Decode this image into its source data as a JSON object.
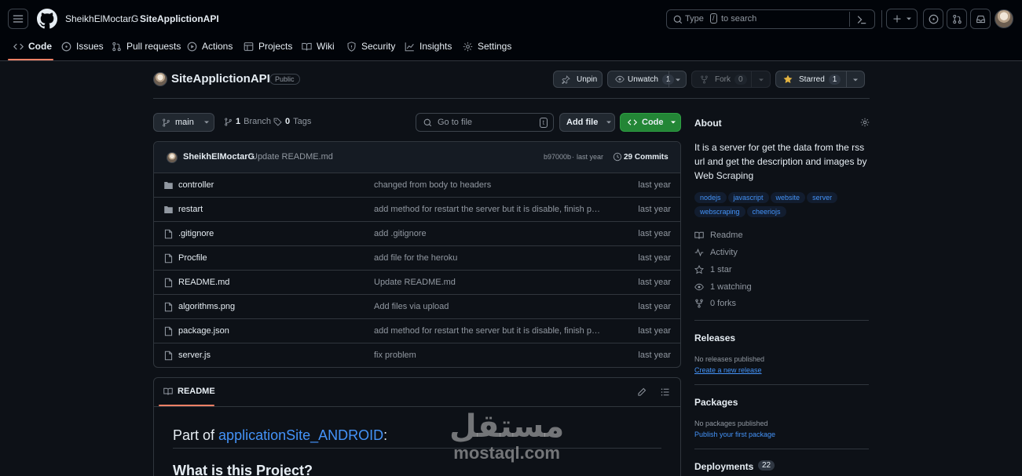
{
  "header": {
    "owner": "SheikhElMoctarG",
    "separator": "/",
    "repo": "SiteApplictionAPI",
    "search_prefix": "Type",
    "search_key": "/",
    "search_suffix": "to search"
  },
  "tabs": [
    {
      "label": "Code",
      "icon": "code-icon",
      "selected": true
    },
    {
      "label": "Issues",
      "icon": "issue-icon"
    },
    {
      "label": "Pull requests",
      "icon": "pull-request-icon"
    },
    {
      "label": "Actions",
      "icon": "play-icon"
    },
    {
      "label": "Projects",
      "icon": "table-icon"
    },
    {
      "label": "Wiki",
      "icon": "book-icon"
    },
    {
      "label": "Security",
      "icon": "shield-icon"
    },
    {
      "label": "Insights",
      "icon": "graph-icon"
    },
    {
      "label": "Settings",
      "icon": "gear-icon"
    }
  ],
  "repo_header": {
    "name": "SiteApplictionAPI",
    "visibility": "Public",
    "unpin_label": "Unpin",
    "unwatch_label": "Unwatch",
    "watch_count": "1",
    "fork_label": "Fork",
    "fork_count": "0",
    "starred_label": "Starred",
    "star_count": "1"
  },
  "toolbar": {
    "branch": "main",
    "branch_count": "1",
    "branch_label": "Branch",
    "tag_count": "0",
    "tag_label": "Tags",
    "go_to_file_placeholder": "Go to file",
    "go_to_file_key": "t",
    "add_file_label": "Add file",
    "code_label": "Code"
  },
  "commit": {
    "author": "SheikhElMoctarG",
    "message": "Update README.md",
    "hash": "b97000b",
    "dot": "·",
    "time": "last year",
    "count_label": "29 Commits"
  },
  "files": [
    {
      "name": "controller",
      "type": "dir",
      "message": "changed from body to headers",
      "date": "last year"
    },
    {
      "name": "restart",
      "type": "dir",
      "message": "add method for restart the server but it is disable, finish proj…",
      "date": "last year"
    },
    {
      "name": ".gitignore",
      "type": "file",
      "message": "add .gitignore",
      "date": "last year"
    },
    {
      "name": "Procfile",
      "type": "file",
      "message": "add file for the heroku",
      "date": "last year"
    },
    {
      "name": "README.md",
      "type": "file",
      "message": "Update README.md",
      "date": "last year"
    },
    {
      "name": "algorithms.png",
      "type": "file",
      "message": "Add files via upload",
      "date": "last year"
    },
    {
      "name": "package.json",
      "type": "file",
      "message": "add method for restart the server but it is disable, finish proj…",
      "date": "last year"
    },
    {
      "name": "server.js",
      "type": "file",
      "message": "fix problem",
      "date": "last year"
    }
  ],
  "readme": {
    "tab_label": "README",
    "heading_prefix": "Part of",
    "heading_link": "applicationSite_ANDROID",
    "heading_suffix": ":",
    "heading2": "What is this Project?"
  },
  "about": {
    "title": "About",
    "description": "It is a server for get the data from the rss url and get the description and images by Web Scraping",
    "topics": [
      "nodejs",
      "javascript",
      "website",
      "server",
      "webscraping",
      "cheeriojs"
    ],
    "meta": [
      {
        "label": "Readme",
        "icon": "book-icon"
      },
      {
        "label": "Activity",
        "icon": "pulse-icon"
      },
      {
        "label": "1 star",
        "icon": "star-icon"
      },
      {
        "label": "1 watching",
        "icon": "eye-icon"
      },
      {
        "label": "0 forks",
        "icon": "fork-icon"
      }
    ]
  },
  "releases": {
    "title": "Releases",
    "empty": "No releases published",
    "link": "Create a new release"
  },
  "packages": {
    "title": "Packages",
    "empty": "No packages published",
    "link": "Publish your first package"
  },
  "deployments": {
    "title": "Deployments",
    "count": "22"
  },
  "watermark": {
    "arabic": "مستقل",
    "latin": "mostaql.com"
  },
  "colors": {
    "background": "#0d1117",
    "header": "#010409",
    "accent_link": "#4493f8",
    "primary_button": "#238636",
    "tab_underline": "#f78166"
  }
}
